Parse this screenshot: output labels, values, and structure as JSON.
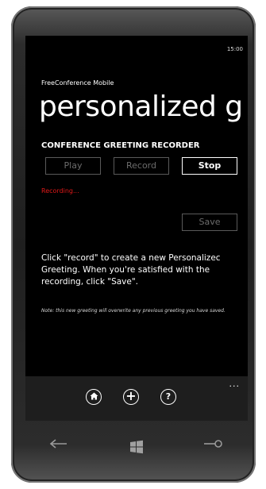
{
  "status_bar": {
    "time": "15:00"
  },
  "app": {
    "title": "FreeConference Mobile"
  },
  "page": {
    "title": "personalized g"
  },
  "recorder": {
    "header": "CONFERENCE GREETING RECORDER",
    "play_label": "Play",
    "record_label": "Record",
    "stop_label": "Stop",
    "status": "Recording...",
    "save_label": "Save"
  },
  "instructions": "Click \"record\" to create a new Personalizec\nGreeting.  When you're satisfied with the recording, click \"Save\".",
  "note": "Note: this new greeting will overwrite any previous greeting you have saved.",
  "app_bar": {
    "icons": [
      "home-icon",
      "add-icon",
      "help-icon"
    ],
    "more": "..."
  },
  "hardware_buttons": [
    "back-icon",
    "windows-start-icon",
    "search-icon"
  ],
  "colors": {
    "background": "#000000",
    "text": "#ffffff",
    "disabled": "#6c6c6c",
    "status_red": "#e01818"
  }
}
